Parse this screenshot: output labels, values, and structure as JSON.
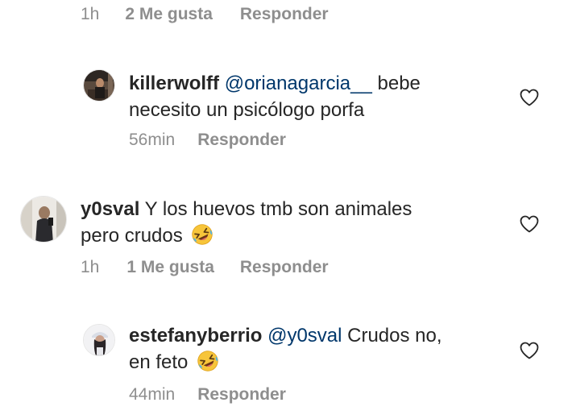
{
  "top_meta": {
    "time": "1h",
    "likes": "2 Me gusta",
    "reply": "Responder"
  },
  "comments": [
    {
      "username": "killerwolff",
      "mention": "@orianagarcia__",
      "text_line1": " bebe",
      "text_line2": "necesito un psicólogo porfa",
      "time": "56min",
      "likes": "",
      "reply": "Responder"
    },
    {
      "username": "y0sval",
      "mention": "",
      "text_line1": " Y los huevos tmb son animales",
      "text_line2": "pero crudos",
      "emoji": "rolling-on-floor-laughing",
      "time": "1h",
      "likes": "1 Me gusta",
      "reply": "Responder"
    },
    {
      "username": "estefanyberrio",
      "mention": "@y0sval",
      "text_line1": " Crudos no,",
      "text_line2": "en feto",
      "emoji": "rolling-on-floor-laughing",
      "time": "44min",
      "likes": "",
      "reply": "Responder"
    }
  ],
  "colors": {
    "text": "#262626",
    "secondary": "#8e8e8e",
    "mention": "#00376b",
    "background": "#ffffff"
  },
  "icons": {
    "like": "heart-outline-icon",
    "emoji": "rolling-on-floor-laughing-emoji"
  }
}
